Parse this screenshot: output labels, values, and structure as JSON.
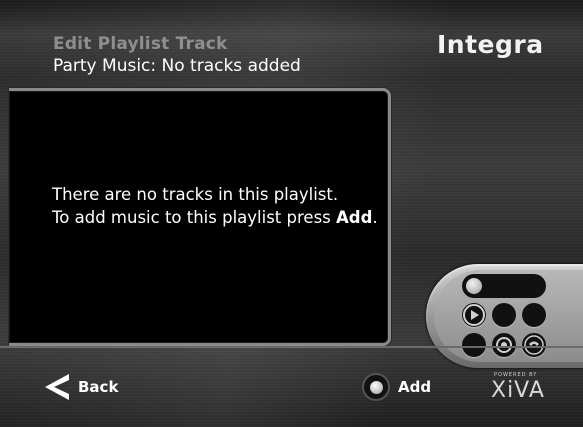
{
  "header": {
    "title": "Edit Playlist Track",
    "subtitle": "Party Music: No tracks added",
    "brand_logo": "Integra"
  },
  "message": {
    "line1": "There are no tracks in this playlist.",
    "line2_prefix": "To add music to this playlist press",
    "line2_bold": "Add",
    "line2_suffix": "."
  },
  "footer": {
    "back_label": "Back",
    "back_icon": "chevron-left-icon",
    "add_label": "Add",
    "add_icon": "button-circle-icon",
    "powered_by": "POWERED BY",
    "powered_brand": "XiVA"
  },
  "remote_icons": [
    "pill-button-icon",
    "play-icon",
    "record-icon",
    "phone-icon"
  ],
  "colors": {
    "background": "#2e2e2e",
    "panel": "#000000",
    "panel_border": "#8a8a8a",
    "title": "#8f8f8f",
    "text": "#ffffff"
  }
}
